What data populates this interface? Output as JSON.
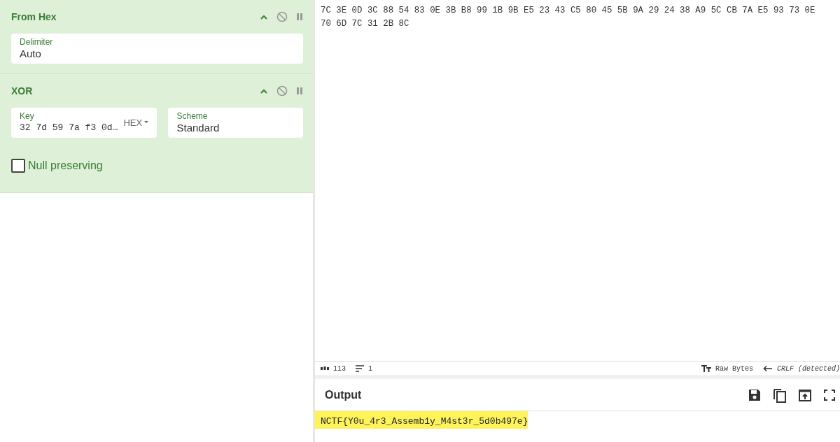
{
  "recipe": [
    {
      "title": "From Hex",
      "fields": [
        {
          "label": "Delimiter",
          "value": "Auto",
          "kind": "text"
        }
      ]
    },
    {
      "title": "XOR",
      "fields": [
        {
          "label": "Key",
          "value": "32 7d 59 7a f3 0d…",
          "kind": "code",
          "toggle": "HEX"
        },
        {
          "label": "Scheme",
          "value": "Standard",
          "kind": "text"
        }
      ],
      "checkboxes": [
        {
          "label": "Null preserving",
          "checked": false
        }
      ]
    }
  ],
  "input": {
    "text": "7C 3E 0D 3C 88 54 83 0E 3B B8 99 1B 9B E5 23 43 C5 80 45 5B 9A 29 24 38 A9 5C CB 7A E5 93 73 0E 70 6D 7C 31 2B 8C",
    "status": {
      "length": "113",
      "lines": "1",
      "encoding": "Raw Bytes",
      "eol": "CRLF (detected)"
    }
  },
  "output": {
    "title": "Output",
    "text": "NCTF{Y0u_4r3_Assemb1y_M4st3r_5d0b497e}",
    "highlighted": true
  }
}
